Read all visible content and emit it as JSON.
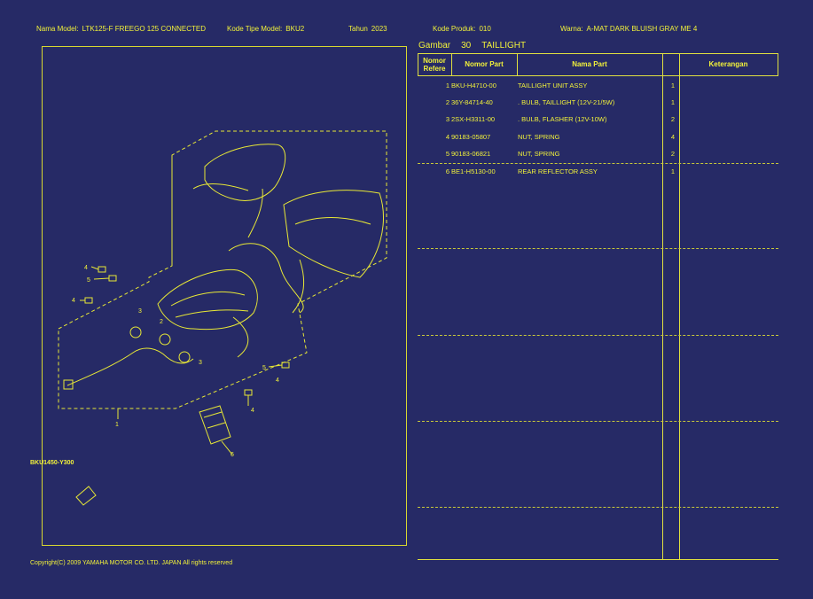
{
  "header": {
    "model_label": "Nama Model:",
    "model_value": "LTK125-F FREEGO 125 CONNECTED",
    "type_label": "Kode Tipe Model:",
    "type_value": "BKU2",
    "year_label": "Tahun",
    "year_value": "2023",
    "product_label": "Kode Produk:",
    "product_value": "010",
    "color_label": "Warna:",
    "color_value": "A-MAT DARK BLUISH GRAY ME 4"
  },
  "section": {
    "label": "Gambar",
    "number": "30",
    "title": "TAILLIGHT"
  },
  "table": {
    "headers": {
      "ref": "Nomor Refere",
      "part_no": "Nomor Part",
      "name": "Nama Part",
      "qty": "",
      "note": "Keterangan"
    },
    "rows": [
      {
        "no": "1",
        "part_no": "BKU-H4710-00",
        "name": "TAILLIGHT UNIT ASSY",
        "qty": "1"
      },
      {
        "no": "2",
        "part_no": "36Y-84714-40",
        "name": ". BULB, TAILLIGHT (12V-21/5W)",
        "qty": "1"
      },
      {
        "no": "3",
        "part_no": "2SX-H3311-00",
        "name": ". BULB, FLASHER (12V-10W)",
        "qty": "2"
      },
      {
        "no": "4",
        "part_no": "90183-05807",
        "name": "NUT, SPRING",
        "qty": "4"
      },
      {
        "no": "5",
        "part_no": "90183-06821",
        "name": "NUT, SPRING",
        "qty": "2"
      },
      {
        "no": "6",
        "part_no": "BE1-H5130-00",
        "name": "REAR REFLECTOR ASSY",
        "qty": "1"
      }
    ]
  },
  "diagram": {
    "code": "BKU1450-Y300",
    "callouts": [
      "1",
      "2",
      "3",
      "3",
      "4",
      "4",
      "4",
      "4",
      "5",
      "5",
      "6"
    ]
  },
  "footer": {
    "copyright": "Copyright(C) 2009 YAMAHA MOTOR CO. LTD. JAPAN All rights reserved"
  },
  "colors": {
    "background": "#262a66",
    "foreground": "#f2f23a"
  }
}
